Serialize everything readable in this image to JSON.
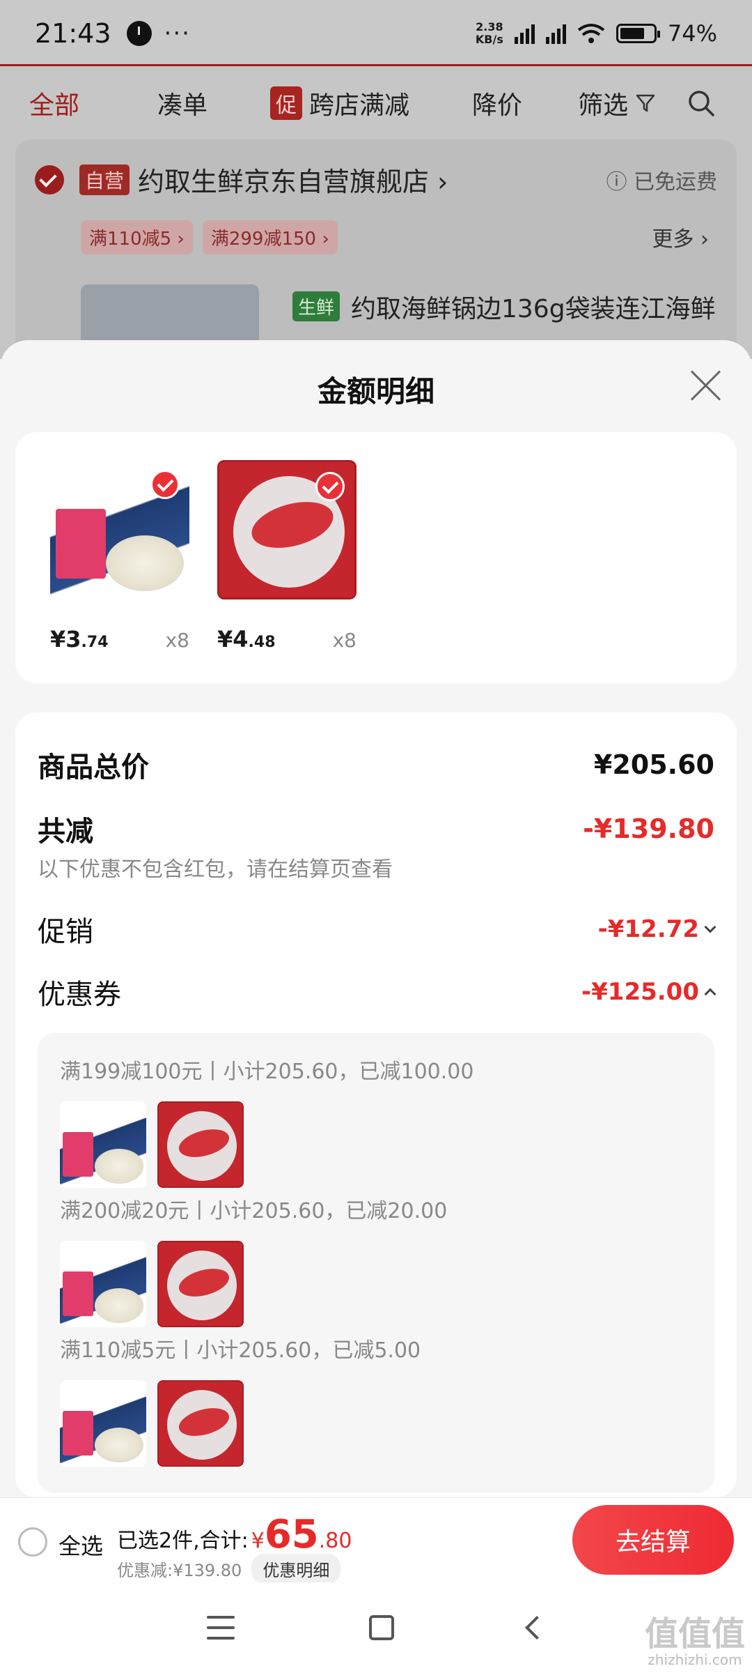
{
  "status_bar": {
    "time": "21:43",
    "dots": "···",
    "speed_top": "2.38",
    "speed_bottom": "KB/s",
    "battery": "74%",
    "battery_level": 0.74
  },
  "filter_bar": {
    "all": "全部",
    "bundle": "凑单",
    "promo_badge": "促",
    "cross_store": "跨店满减",
    "price_drop": "降价",
    "filter": "筛选"
  },
  "store": {
    "badge": "自营",
    "name": "约取生鲜京东自营旗舰店",
    "chevron": "›",
    "shipping": "ⓘ 已免运费",
    "promos": [
      "满110减5 ›",
      "满299减150 ›"
    ],
    "more": "更多 ›",
    "fresh_badge": "生鲜",
    "product_title": "约取海鲜锅边136g袋装连江海鲜"
  },
  "sheet": {
    "title": "金额明细",
    "products": [
      {
        "yen": "¥",
        "int": "3",
        "dec": ".74",
        "qty": "x8"
      },
      {
        "yen": "¥",
        "int": "4",
        "dec": ".48",
        "qty": "x8"
      }
    ],
    "total_label": "商品总价",
    "total_value": "¥205.60",
    "reduce_label": "共减",
    "reduce_value": "-¥139.80",
    "note": "以下优惠不包含红包，请在结算页查看",
    "promo_label": "促销",
    "promo_value": "-¥12.72",
    "coupon_label": "优惠券",
    "coupon_value": "-¥125.00",
    "coupons": [
      "满199减100元丨小计205.60，已减100.00",
      "满200减20元丨小计205.60，已减20.00",
      "满110减5元丨小计205.60，已减5.00"
    ]
  },
  "bottom_bar": {
    "select_all": "全选",
    "selected_text": "已选2件,合计:",
    "yen": "¥",
    "total_int": "65",
    "total_dec": ".80",
    "discount_text": "优惠减:¥139.80",
    "discount_detail": "优惠明细",
    "checkout": "去结算"
  },
  "watermark": {
    "big": "值值值",
    "small": "zhizhizhi.com"
  },
  "colors": {
    "accent": "#e62a2a",
    "checkout": "#ef2a33"
  }
}
